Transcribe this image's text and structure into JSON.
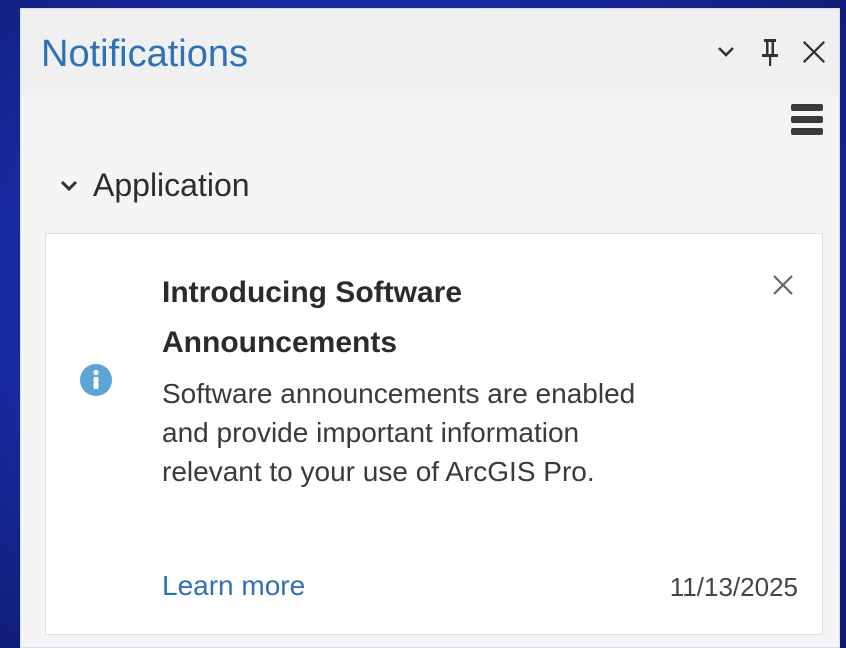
{
  "pane": {
    "title": "Notifications",
    "controls": {
      "dropdown_icon": "chevron-down-icon",
      "pin_icon": "pin-icon",
      "close_icon": "close-icon",
      "menu_icon": "hamburger-menu-icon"
    }
  },
  "group": {
    "label": "Application",
    "expanded": true
  },
  "notification": {
    "icon": "info-icon",
    "title": "Introducing Software Announcements",
    "body": "Software announcements are enabled and provide important information relevant to your use of ArcGIS Pro.",
    "link_label": "Learn more",
    "date": "11/13/2025"
  },
  "colors": {
    "accent": "#2f71b7",
    "info_icon": "#5ba4d8",
    "background": "#1a2fb0"
  }
}
